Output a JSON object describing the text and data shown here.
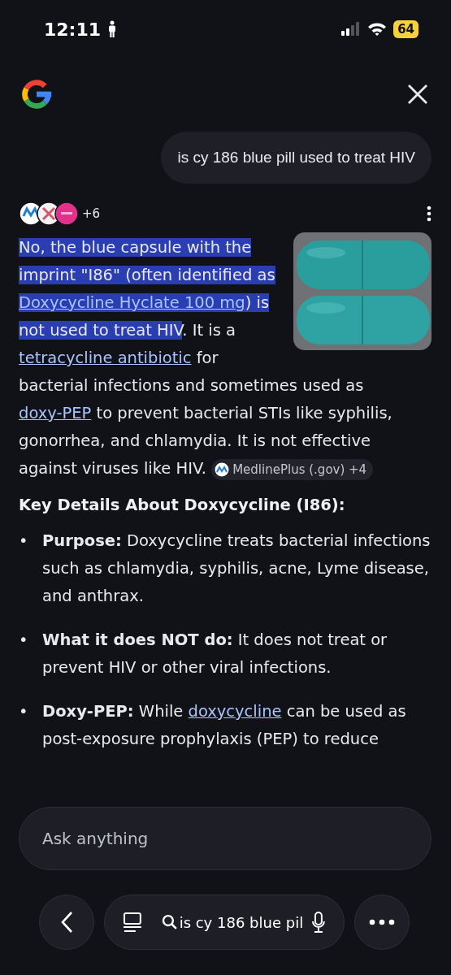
{
  "status_bar": {
    "time": "12:11",
    "battery": "64"
  },
  "query": "is cy 186 blue pill used to treat HIV",
  "sources": {
    "count": "+6"
  },
  "answer": {
    "segments": [
      {
        "text": "No, the blue capsule with the imprint \"I86\" (often identified as ",
        "kind": "plain",
        "highlighted": true
      },
      {
        "text": "Doxycycline Hyclate 100 mg",
        "kind": "link",
        "highlighted": true
      },
      {
        "text": ") is not used to treat HIV",
        "kind": "plain",
        "highlighted": true
      },
      {
        "text": ". It is a ",
        "kind": "plain",
        "highlighted": false
      },
      {
        "text": "tetracycline antibiotic",
        "kind": "link",
        "highlighted": false
      },
      {
        "text": " for bacterial infections and sometimes used as ",
        "kind": "plain",
        "highlighted": false
      },
      {
        "text": "doxy-PEP",
        "kind": "link",
        "highlighted": false
      },
      {
        "text": " to prevent bacterial STIs like syphilis, gonorrhea, and chlamydia. It is not effective against viruses like HIV. ",
        "kind": "plain",
        "highlighted": false
      }
    ],
    "source_chip": "MedlinePlus (.gov) +4"
  },
  "heading": "Key Details About Doxycycline (I86):",
  "bullets": [
    {
      "marker": "•",
      "label": "Purpose:",
      "segments": [
        {
          "text": " Doxycycline treats bacterial infections such as chlamydia, syphilis, acne, Lyme disease, and anthrax.",
          "kind": "plain"
        }
      ]
    },
    {
      "marker": "•",
      "label": "What it does NOT do:",
      "segments": [
        {
          "text": " It does not treat or prevent HIV or other viral infections.",
          "kind": "plain"
        }
      ]
    },
    {
      "marker": "•",
      "label": "Doxy-PEP:",
      "segments": [
        {
          "text": " While ",
          "kind": "plain"
        },
        {
          "text": "doxycycline",
          "kind": "link"
        },
        {
          "text": " can be used as post-exposure prophylaxis (PEP) to reduce",
          "kind": "plain"
        }
      ]
    }
  ],
  "ask_field": {
    "placeholder": "Ask anything"
  },
  "bottom_bar": {
    "search_text": "is cy 186 blue pil"
  }
}
